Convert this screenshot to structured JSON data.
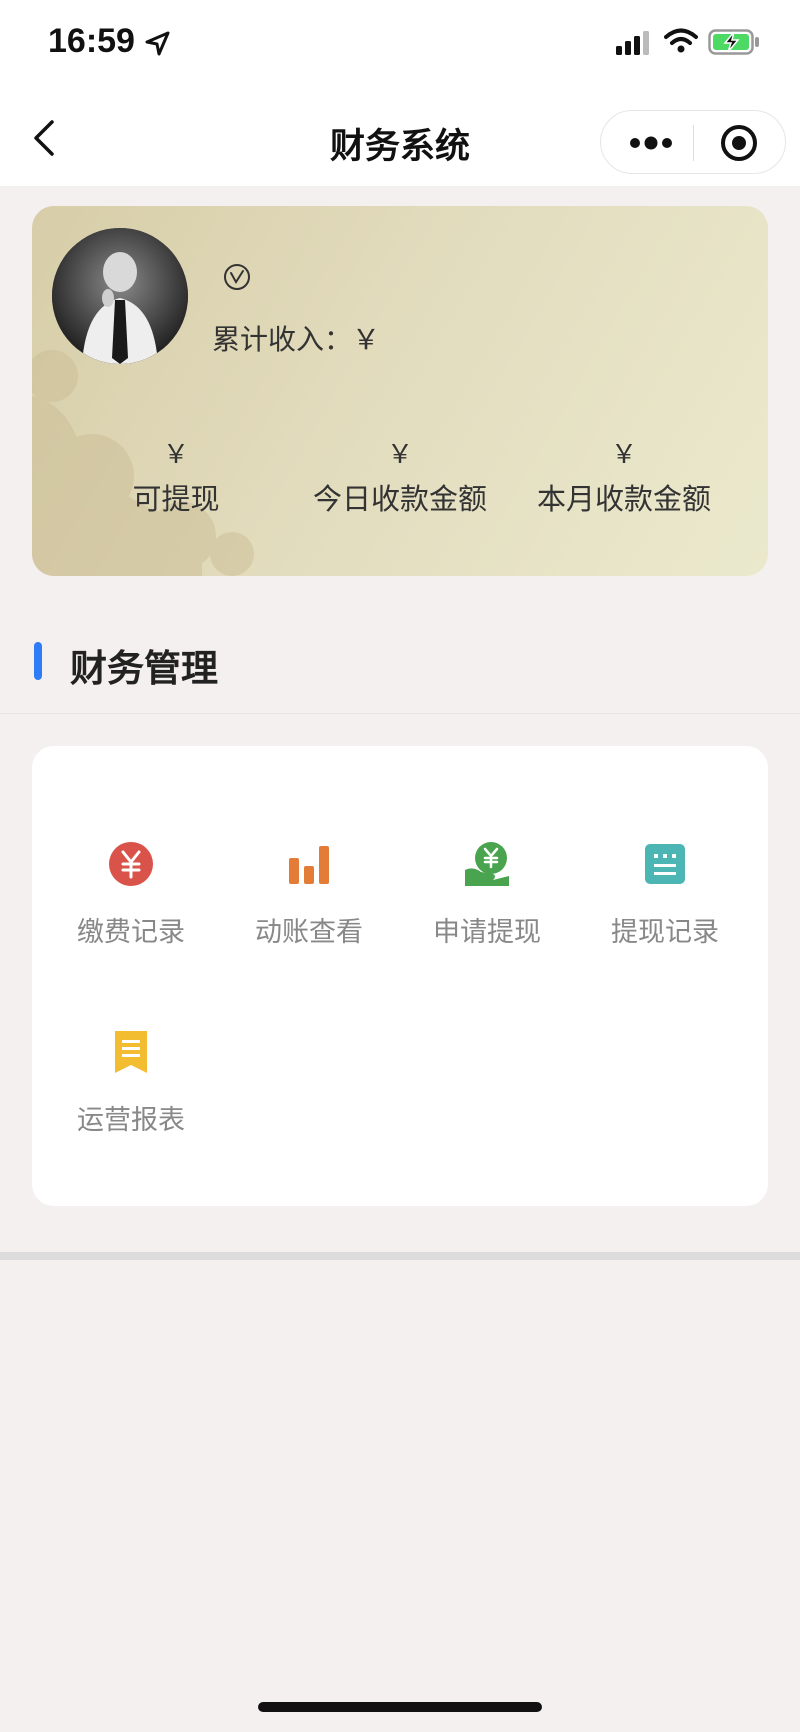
{
  "status_bar": {
    "time": "16:59"
  },
  "nav": {
    "title": "财务系统"
  },
  "profile": {
    "income_label": "累计收入：￥",
    "stats": [
      {
        "value": "￥",
        "label": "可提现"
      },
      {
        "value": "￥",
        "label": "今日收款金额"
      },
      {
        "value": "￥",
        "label": "本月收款金额"
      }
    ]
  },
  "section": {
    "title": "财务管理"
  },
  "menu": {
    "items": [
      {
        "label": "缴费记录",
        "icon": "yuan-circle-icon",
        "color": "#d9534a"
      },
      {
        "label": "动账查看",
        "icon": "bar-chart-icon",
        "color": "#e27c37"
      },
      {
        "label": "申请提现",
        "icon": "hand-yuan-icon",
        "color": "#4aa44f"
      },
      {
        "label": "提现记录",
        "icon": "list-record-icon",
        "color": "#4bb6b4"
      },
      {
        "label": "运营报表",
        "icon": "report-bookmark-icon",
        "color": "#f2bd30"
      }
    ]
  },
  "colors": {
    "accent": "#2f7df6",
    "card_gradient_start": "#d7cda8",
    "card_gradient_end": "#ebe9cd"
  }
}
